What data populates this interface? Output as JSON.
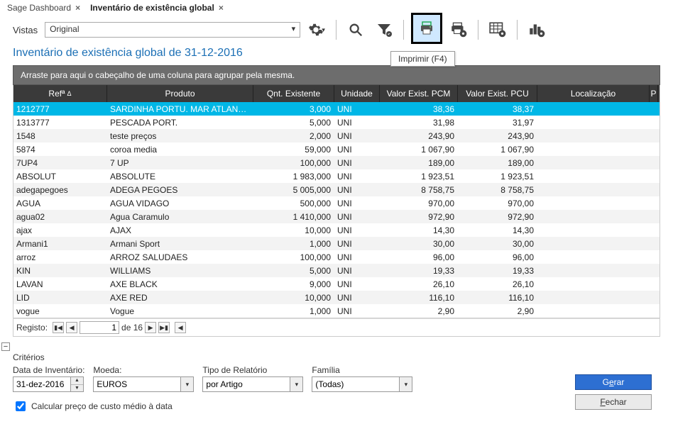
{
  "tabs": [
    {
      "label": "Sage Dashboard",
      "active": false
    },
    {
      "label": "Inventário de existência global",
      "active": true
    }
  ],
  "vistas": {
    "label": "Vistas",
    "value": "Original"
  },
  "tooltip": "Imprimir (F4)",
  "page_title": "Inventário de existência global de 31-12-2016",
  "group_hint": "Arraste para aqui o cabeçalho de uma coluna para agrupar pela mesma.",
  "columns": [
    "Refª",
    "Produto",
    "Qnt. Existente",
    "Unidade",
    "Valor Exist. PCM",
    "Valor Exist. PCU",
    "Localização",
    "P"
  ],
  "sort_indicator": "Δ",
  "rows": [
    {
      "ref": "1212777",
      "prod": "SARDINHA PORTU. MAR ATLANTIC",
      "qnt": "3,000",
      "uni": "UNI",
      "pcm": "38,36",
      "pcu": "38,37",
      "loc": "",
      "sel": true
    },
    {
      "ref": "1313777",
      "prod": "PESCADA PORT.",
      "qnt": "5,000",
      "uni": "UNI",
      "pcm": "31,98",
      "pcu": "31,97",
      "loc": ""
    },
    {
      "ref": "1548",
      "prod": "teste preços",
      "qnt": "2,000",
      "uni": "UNI",
      "pcm": "243,90",
      "pcu": "243,90",
      "loc": ""
    },
    {
      "ref": "5874",
      "prod": "coroa media",
      "qnt": "59,000",
      "uni": "UNI",
      "pcm": "1 067,90",
      "pcu": "1 067,90",
      "loc": ""
    },
    {
      "ref": "7UP4",
      "prod": "7 UP",
      "qnt": "100,000",
      "uni": "UNI",
      "pcm": "189,00",
      "pcu": "189,00",
      "loc": ""
    },
    {
      "ref": "ABSOLUT",
      "prod": "ABSOLUTE",
      "qnt": "1 983,000",
      "uni": "UNI",
      "pcm": "1 923,51",
      "pcu": "1 923,51",
      "loc": ""
    },
    {
      "ref": "adegapegoes",
      "prod": "ADEGA PEGOES",
      "qnt": "5 005,000",
      "uni": "UNI",
      "pcm": "8 758,75",
      "pcu": "8 758,75",
      "loc": ""
    },
    {
      "ref": "AGUA",
      "prod": "AGUA VIDAGO",
      "qnt": "500,000",
      "uni": "UNI",
      "pcm": "970,00",
      "pcu": "970,00",
      "loc": ""
    },
    {
      "ref": "agua02",
      "prod": "Agua Caramulo",
      "qnt": "1 410,000",
      "uni": "UNI",
      "pcm": "972,90",
      "pcu": "972,90",
      "loc": ""
    },
    {
      "ref": "ajax",
      "prod": "AJAX",
      "qnt": "10,000",
      "uni": "UNI",
      "pcm": "14,30",
      "pcu": "14,30",
      "loc": ""
    },
    {
      "ref": "Armani1",
      "prod": "Armani Sport",
      "qnt": "1,000",
      "uni": "UNI",
      "pcm": "30,00",
      "pcu": "30,00",
      "loc": ""
    },
    {
      "ref": "arroz",
      "prod": "ARROZ SALUDAES",
      "qnt": "100,000",
      "uni": "UNI",
      "pcm": "96,00",
      "pcu": "96,00",
      "loc": ""
    },
    {
      "ref": "KIN",
      "prod": "WILLIAMS",
      "qnt": "5,000",
      "uni": "UNI",
      "pcm": "19,33",
      "pcu": "19,33",
      "loc": ""
    },
    {
      "ref": "LAVAN",
      "prod": "AXE BLACK",
      "qnt": "9,000",
      "uni": "UNI",
      "pcm": "26,10",
      "pcu": "26,10",
      "loc": ""
    },
    {
      "ref": "LID",
      "prod": "AXE RED",
      "qnt": "10,000",
      "uni": "UNI",
      "pcm": "116,10",
      "pcu": "116,10",
      "loc": ""
    },
    {
      "ref": "vogue",
      "prod": "Vogue",
      "qnt": "1,000",
      "uni": "UNI",
      "pcm": "2,90",
      "pcu": "2,90",
      "loc": ""
    }
  ],
  "pager": {
    "label": "Registo:",
    "current": "1",
    "total": "de 16"
  },
  "section_toggle": "−",
  "criteria": {
    "title": "Critérios",
    "data_label": "Data de Inventário:",
    "data_value": "31-dez-2016",
    "moeda_label": "Moeda:",
    "moeda_value": "EUROS",
    "tipo_label": "Tipo de Relatório",
    "tipo_value": "por Artigo",
    "familia_label": "Família",
    "familia_value": "(Todas)",
    "chk_label": "Calcular preço de custo médio à data"
  },
  "buttons": {
    "gerar_pre": "G",
    "gerar_ul": "e",
    "gerar_post": "rar",
    "fechar_pre": "",
    "fechar_ul": "F",
    "fechar_post": "echar"
  }
}
